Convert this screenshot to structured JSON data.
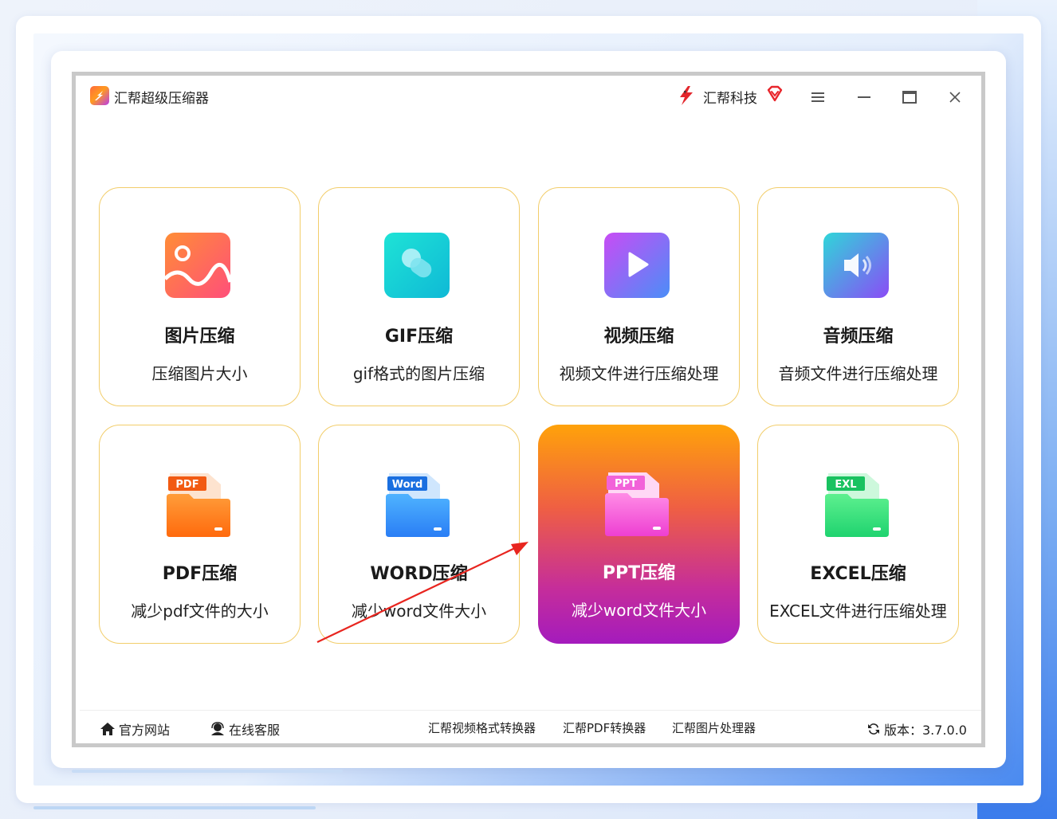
{
  "window": {
    "app_title": "汇帮超级压缩器",
    "brand_name": "汇帮科技"
  },
  "tiles": [
    {
      "title": "图片压缩",
      "subtitle": "压缩图片大小",
      "icon": "image-icon"
    },
    {
      "title": "GIF压缩",
      "subtitle": "gif格式的图片压缩",
      "icon": "gif-icon"
    },
    {
      "title": "视频压缩",
      "subtitle": "视频文件进行压缩处理",
      "icon": "video-play-icon"
    },
    {
      "title": "音频压缩",
      "subtitle": "音频文件进行压缩处理",
      "icon": "audio-speaker-icon"
    },
    {
      "title": "PDF压缩",
      "subtitle": "减少pdf文件的大小",
      "icon": "pdf-folder-icon",
      "badge": "PDF"
    },
    {
      "title": "WORD压缩",
      "subtitle": "减少word文件大小",
      "icon": "word-folder-icon",
      "badge": "Word"
    },
    {
      "title": "PPT压缩",
      "subtitle": "减少word文件大小",
      "icon": "ppt-folder-icon",
      "badge": "PPT",
      "active": true
    },
    {
      "title": "EXCEL压缩",
      "subtitle": "EXCEL文件进行压缩处理",
      "icon": "excel-folder-icon",
      "badge": "EXL"
    }
  ],
  "footer": {
    "home": "官方网站",
    "service": "在线客服",
    "links": [
      "汇帮视频格式转换器",
      "汇帮PDF转换器",
      "汇帮图片处理器"
    ],
    "version": "版本：3.7.0.0"
  },
  "colors": {
    "tile_border": "#f2cd6a",
    "active_gradient_top": "#ffa20a",
    "active_gradient_bottom": "#a41bbd",
    "annotation_arrow": "#e8251f"
  }
}
